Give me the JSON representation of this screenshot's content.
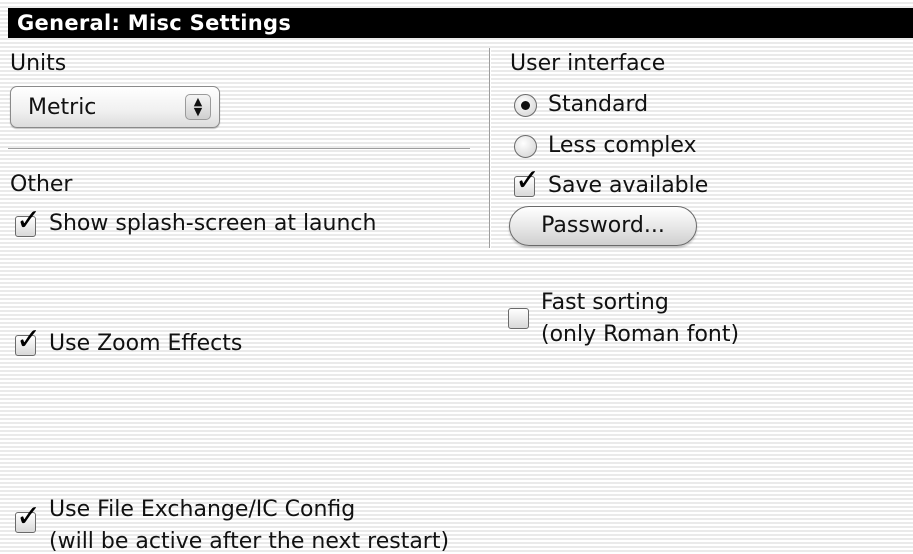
{
  "title": "General: Misc Settings",
  "units": {
    "label": "Units",
    "selected": "Metric"
  },
  "other": {
    "label": "Other",
    "show_splash": {
      "label": "Show splash-screen at launch",
      "checked": true
    },
    "zoom_effects": {
      "label": "Use Zoom Effects",
      "checked": true
    },
    "file_exchange": {
      "line1": "Use File Exchange/IC Config",
      "line2": "(will be active after the next restart)",
      "checked": true
    }
  },
  "user_interface": {
    "label": "User interface",
    "standard": {
      "label": "Standard",
      "selected": true
    },
    "less_complex": {
      "label": "Less complex",
      "selected": false
    },
    "save_available": {
      "label": "Save available",
      "checked": true
    },
    "password_button": "Password..."
  },
  "fast_sorting": {
    "line1": "Fast sorting",
    "line2": "(only Roman font)",
    "checked": false
  },
  "icons": {
    "check": "checkmark-icon",
    "popup_arrows": "up-down-arrows-icon"
  }
}
